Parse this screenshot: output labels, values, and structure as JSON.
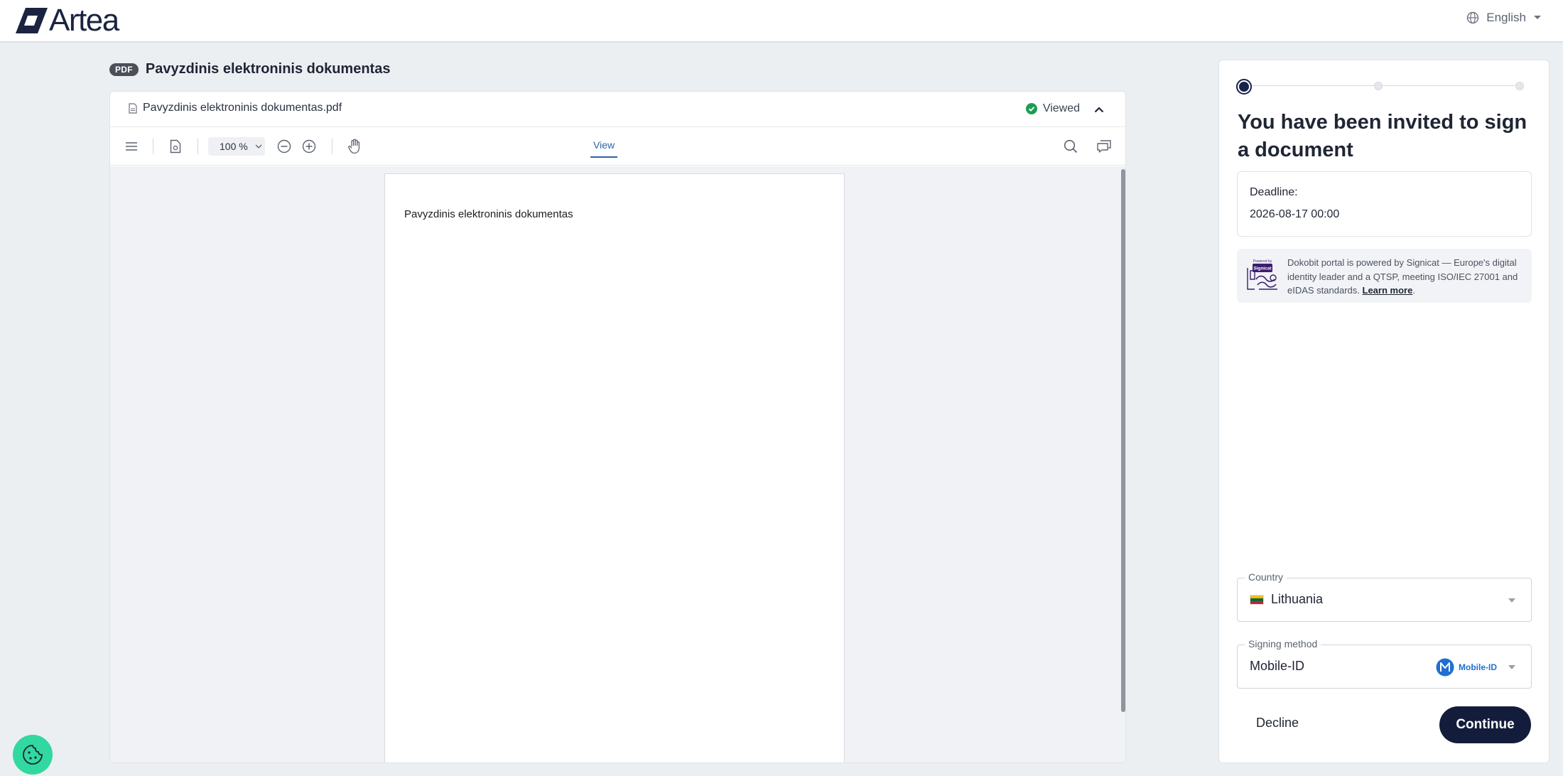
{
  "brand": {
    "name": "Artea",
    "logo_color": "#1a2440"
  },
  "header": {
    "language": "English"
  },
  "document": {
    "badge": "PDF",
    "title": "Pavyzdinis elektroninis dokumentas",
    "file_name": "Pavyzdinis elektroninis dokumentas.pdf",
    "status": "Viewed",
    "status_color": "#1f9d55"
  },
  "toolbar": {
    "zoom": "100",
    "zoom_unit": "%",
    "tab_view": "View"
  },
  "page": {
    "text": "Pavyzdinis elektroninis dokumentas"
  },
  "panel": {
    "title": "You have been invited to sign a document",
    "steps": {
      "total": 3,
      "current": 1
    },
    "deadline_label": "Deadline:",
    "deadline_value": "2026-08-17 00:00",
    "info_text": "Dokobit portal is powered by Signicat — Europe's digital identity leader and a QTSP, meeting ISO/IEC 27001 and eIDAS standards.",
    "info_link": "Learn more",
    "info_end": ".",
    "info_logo_top": "Powered by",
    "info_logo_brand": "Signicat",
    "country_label": "Country",
    "country_value": "Lithuania",
    "method_label": "Signing method",
    "method_value": "Mobile-ID",
    "method_badge": "Mobile-ID",
    "decline": "Decline",
    "continue": "Continue",
    "accent": "#131c3b"
  }
}
